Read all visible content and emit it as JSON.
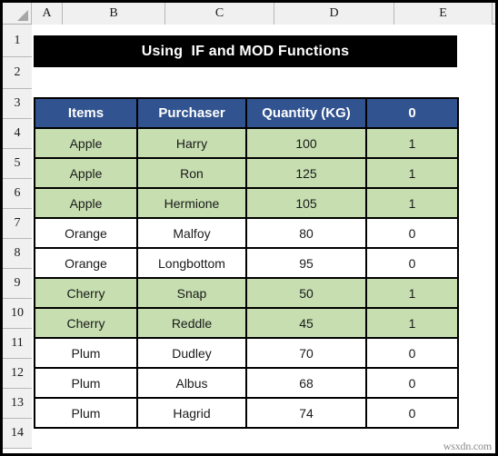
{
  "window": {
    "corner_icon": "select-all-triangle-icon"
  },
  "grid": {
    "columns": [
      {
        "label": "A",
        "width": 34
      },
      {
        "label": "B",
        "width": 113
      },
      {
        "label": "C",
        "width": 120
      },
      {
        "label": "D",
        "width": 132
      },
      {
        "label": "E",
        "width": 108
      }
    ],
    "rows": [
      {
        "label": "1",
        "height": 36
      },
      {
        "label": "2",
        "height": 35
      },
      {
        "label": "3",
        "height": 33
      },
      {
        "label": "4",
        "height": 33
      },
      {
        "label": "5",
        "height": 33
      },
      {
        "label": "6",
        "height": 33
      },
      {
        "label": "7",
        "height": 33
      },
      {
        "label": "8",
        "height": 33
      },
      {
        "label": "9",
        "height": 33
      },
      {
        "label": "10",
        "height": 33
      },
      {
        "label": "11",
        "height": 33
      },
      {
        "label": "12",
        "height": 33
      },
      {
        "label": "13",
        "height": 33
      },
      {
        "label": "14",
        "height": 33
      }
    ]
  },
  "title_banner": {
    "text": "Using  IF and MOD Functions",
    "background": "#000000",
    "color": "#ffffff"
  },
  "table": {
    "header_background": "#31538F",
    "header_color": "#ffffff",
    "highlight_background": "#C6DEB0",
    "headers": [
      "Items",
      "Purchaser",
      "Quantity (KG)",
      "0"
    ],
    "rows": [
      {
        "items": "Apple",
        "purchaser": "Harry",
        "quantity": "100",
        "flag": "1",
        "highlighted": true
      },
      {
        "items": "Apple",
        "purchaser": "Ron",
        "quantity": "125",
        "flag": "1",
        "highlighted": true
      },
      {
        "items": "Apple",
        "purchaser": "Hermione",
        "quantity": "105",
        "flag": "1",
        "highlighted": true
      },
      {
        "items": "Orange",
        "purchaser": "Malfoy",
        "quantity": "80",
        "flag": "0",
        "highlighted": false
      },
      {
        "items": "Orange",
        "purchaser": "Longbottom",
        "quantity": "95",
        "flag": "0",
        "highlighted": false
      },
      {
        "items": "Cherry",
        "purchaser": "Snap",
        "quantity": "50",
        "flag": "1",
        "highlighted": true
      },
      {
        "items": "Cherry",
        "purchaser": "Reddle",
        "quantity": "45",
        "flag": "1",
        "highlighted": true
      },
      {
        "items": "Plum",
        "purchaser": "Dudley",
        "quantity": "70",
        "flag": "0",
        "highlighted": false
      },
      {
        "items": "Plum",
        "purchaser": "Albus",
        "quantity": "68",
        "flag": "0",
        "highlighted": false
      },
      {
        "items": "Plum",
        "purchaser": "Hagrid",
        "quantity": "74",
        "flag": "0",
        "highlighted": false
      }
    ]
  },
  "watermark": {
    "text": "wsxdn.com"
  }
}
